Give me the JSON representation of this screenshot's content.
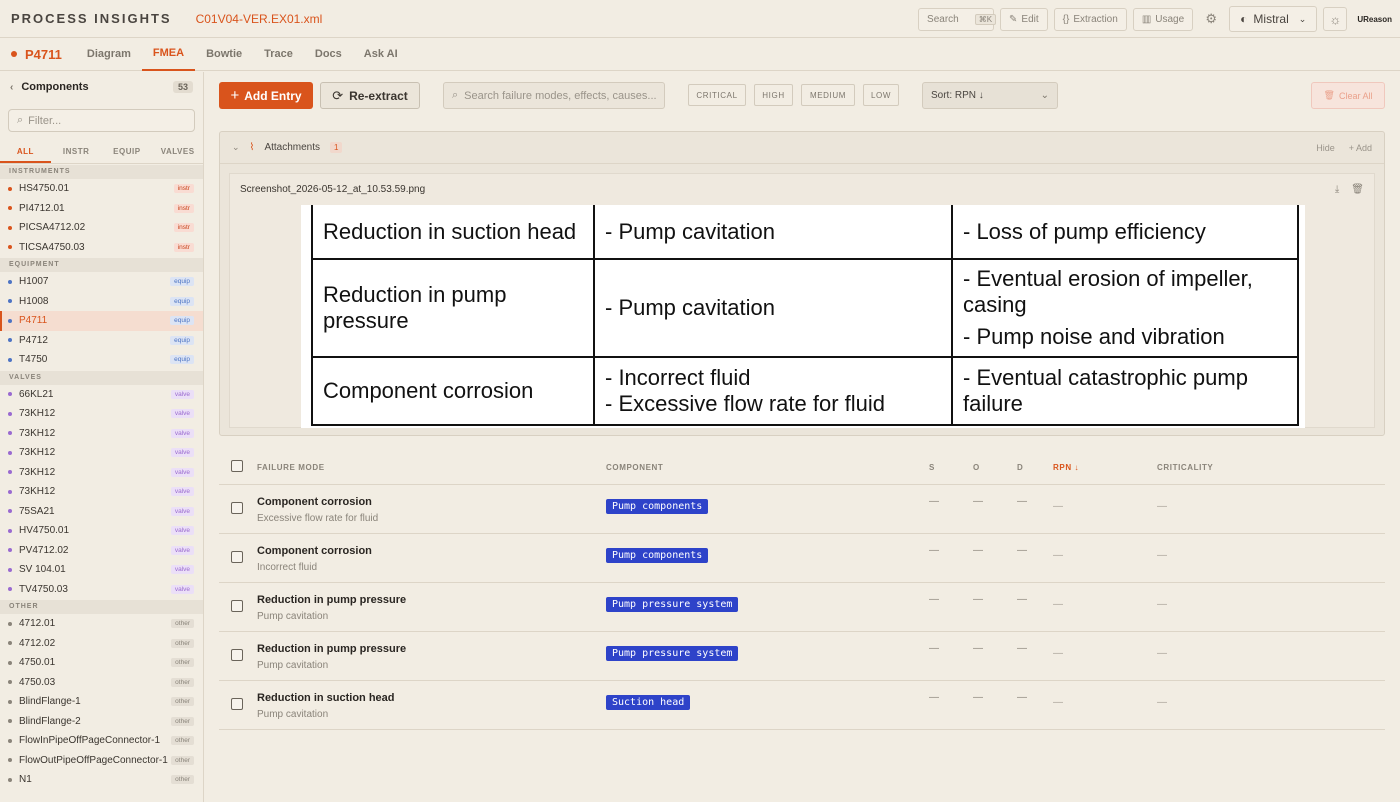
{
  "app": {
    "brand": "PROCESS INSIGHTS",
    "filename": "C01V04-VER.EX01.xml",
    "search_label": "Search",
    "search_shortcut": "⌘K",
    "edit_label": "Edit",
    "extraction_label": "Extraction",
    "usage_label": "Usage",
    "model": "Mistral",
    "org": "UReason"
  },
  "nav": {
    "asset": "P4711",
    "tabs": [
      "Diagram",
      "FMEA",
      "Bowtie",
      "Trace",
      "Docs",
      "Ask AI"
    ],
    "active_tab": "FMEA"
  },
  "sidebar": {
    "title": "Components",
    "count": "53",
    "filter_placeholder": "Filter...",
    "tabs": [
      "ALL",
      "INSTR",
      "EQUIP",
      "VALVES"
    ],
    "groups": [
      {
        "label": "INSTRUMENTS",
        "type": "instr",
        "items": [
          "HS4750.01",
          "PI4712.01",
          "PICSA4712.02",
          "TICSA4750.03"
        ]
      },
      {
        "label": "EQUIPMENT",
        "type": "equip",
        "items": [
          "H1007",
          "H1008",
          "P4711",
          "P4712",
          "T4750"
        ]
      },
      {
        "label": "VALVES",
        "type": "valve",
        "items": [
          "66KL21",
          "73KH12",
          "73KH12",
          "73KH12",
          "73KH12",
          "73KH12",
          "75SA21",
          "HV4750.01",
          "PV4712.02",
          "SV 104.01",
          "TV4750.03"
        ]
      },
      {
        "label": "OTHER",
        "type": "other",
        "items": [
          "4712.01",
          "4712.02",
          "4750.01",
          "4750.03",
          "BlindFlange-1",
          "BlindFlange-2",
          "FlowInPipeOffPageConnector-1",
          "FlowOutPipeOffPageConnector-1",
          "N1"
        ]
      }
    ],
    "selected": "P4711",
    "badges": {
      "instr": "instr",
      "equip": "equip",
      "valve": "valve",
      "other": "other"
    },
    "colors": {
      "instr": "#d9541c",
      "equip": "#4d74c4",
      "valve": "#9a6ad0",
      "other": "#8a847a"
    }
  },
  "toolbar": {
    "add_label": "Add Entry",
    "reextract_label": "Re-extract",
    "search_placeholder": "Search failure modes, effects, causes...",
    "chips": [
      "CRITICAL",
      "HIGH",
      "MEDIUM",
      "LOW"
    ],
    "sort_label": "Sort: RPN ↓",
    "clear_label": "Clear All"
  },
  "attachments": {
    "title": "Attachments",
    "count": "1",
    "hide_label": "Hide",
    "add_label": "+ Add",
    "file_name": "Screenshot_2026-05-12_at_10.53.59.png",
    "image_table": [
      {
        "mode": "Reduction in suction head",
        "cause": "- Pump cavitation",
        "effects": [
          "- Loss of pump efficiency"
        ]
      },
      {
        "mode": "Reduction in pump pressure",
        "cause": "- Pump cavitation",
        "effects": [
          "- Eventual erosion of impeller, casing",
          "- Pump noise and vibration"
        ]
      },
      {
        "mode": "Component corrosion",
        "cause": "- Incorrect fluid\n- Excessive flow rate for fluid",
        "effects": [
          "- Eventual catastrophic pump failure"
        ]
      }
    ]
  },
  "fmea": {
    "headers": {
      "failure_mode": "FAILURE MODE",
      "component": "COMPONENT",
      "s": "S",
      "o": "O",
      "d": "D",
      "rpn": "RPN ↓",
      "criticality": "CRITICALITY"
    },
    "rows": [
      {
        "title": "Component corrosion",
        "sub": "Excessive flow rate for fluid",
        "component": "Pump components",
        "s": "—",
        "o": "—",
        "d": "—",
        "rpn": "—",
        "crit": "—"
      },
      {
        "title": "Component corrosion",
        "sub": "Incorrect fluid",
        "component": "Pump components",
        "s": "—",
        "o": "—",
        "d": "—",
        "rpn": "—",
        "crit": "—"
      },
      {
        "title": "Reduction in pump pressure",
        "sub": "Pump cavitation",
        "component": "Pump pressure system",
        "s": "—",
        "o": "—",
        "d": "—",
        "rpn": "—",
        "crit": "—"
      },
      {
        "title": "Reduction in pump pressure",
        "sub": "Pump cavitation",
        "component": "Pump pressure system",
        "s": "—",
        "o": "—",
        "d": "—",
        "rpn": "—",
        "crit": "—"
      },
      {
        "title": "Reduction in suction head",
        "sub": "Pump cavitation",
        "component": "Suction head",
        "s": "—",
        "o": "—",
        "d": "—",
        "rpn": "—",
        "crit": "—"
      }
    ]
  }
}
